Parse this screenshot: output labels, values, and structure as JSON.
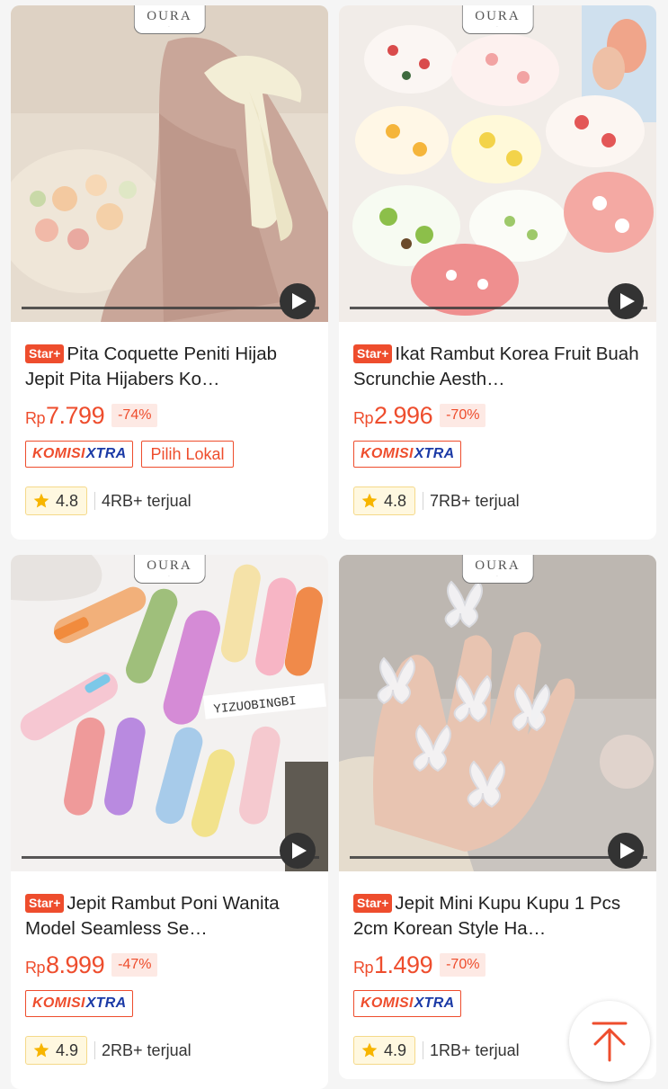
{
  "products": [
    {
      "tag": "Star+",
      "title": "Pita Coquette Peniti Hijab Jepit Pita Hijabers Ko…",
      "currency": "Rp",
      "price": "7.799",
      "discount": "-74%",
      "komisi_a": "KOMISI",
      "komisi_b": "XTRA",
      "lokal": "Pilih Lokal",
      "rating": "4.8",
      "sold": "4RB+ terjual",
      "brand": "OURA"
    },
    {
      "tag": "Star+",
      "title": "Ikat Rambut Korea Fruit Buah Scrunchie Aesth…",
      "currency": "Rp",
      "price": "2.996",
      "discount": "-70%",
      "komisi_a": "KOMISI",
      "komisi_b": "XTRA",
      "rating": "4.8",
      "sold": "7RB+ terjual",
      "brand": "OURA"
    },
    {
      "tag": "Star+",
      "title": "Jepit Rambut Poni Wanita Model Seamless Se…",
      "currency": "Rp",
      "price": "8.999",
      "discount": "-47%",
      "komisi_a": "KOMISI",
      "komisi_b": "XTRA",
      "rating": "4.9",
      "sold": "2RB+ terjual",
      "brand": "OURA"
    },
    {
      "tag": "Star+",
      "title": "Jepit Mini Kupu Kupu 1 Pcs 2cm Korean Style Ha…",
      "currency": "Rp",
      "price": "1.499",
      "discount": "-70%",
      "komisi_a": "KOMISI",
      "komisi_b": "XTRA",
      "rating": "4.9",
      "sold": "1RB+ terjual",
      "brand": "OURA"
    }
  ],
  "colors": {
    "accent": "#ee4d2d",
    "komisi_blue": "#1b3aa6",
    "star": "#f7b500",
    "background": "#f5f5f5"
  },
  "icons": [
    "play-icon",
    "star-icon",
    "scroll-to-top-arrow-icon"
  ]
}
